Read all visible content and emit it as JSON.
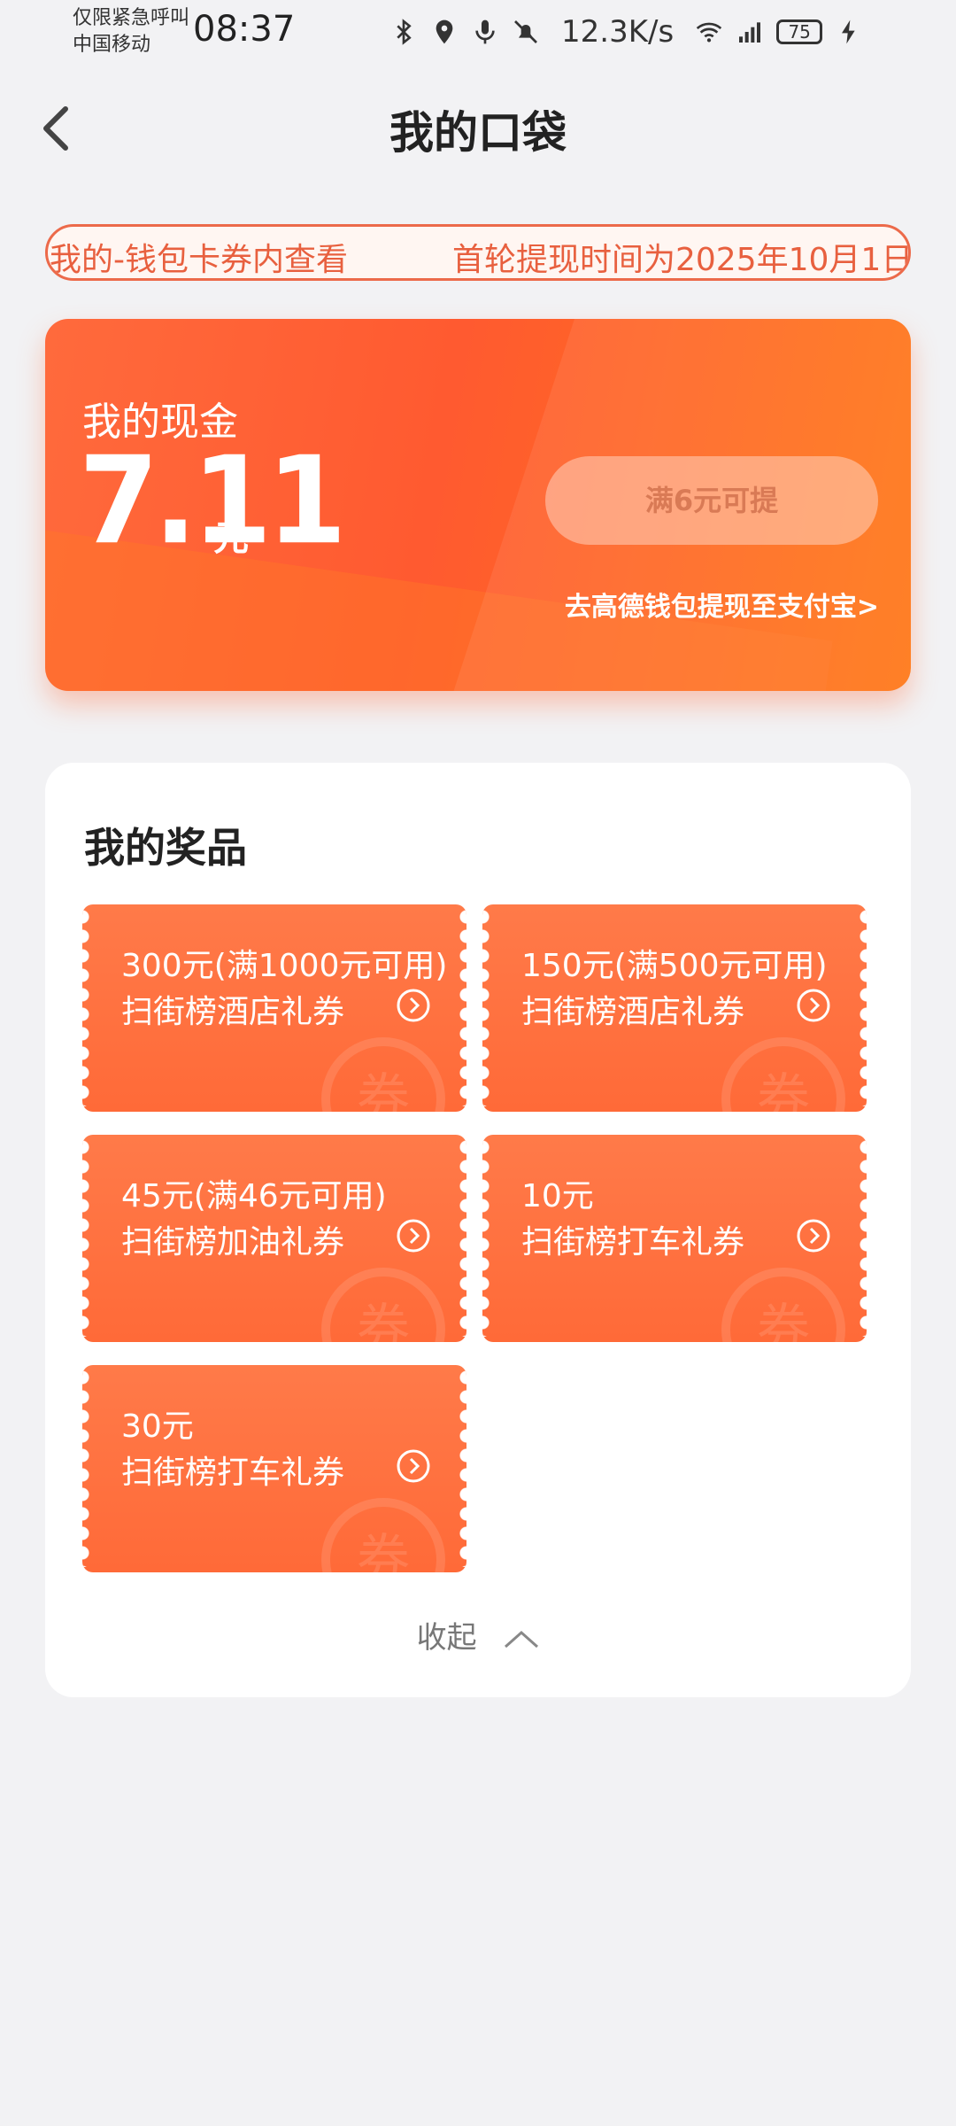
{
  "status_bar": {
    "carrier_line1": "仅限紧急呼叫",
    "carrier_line2": "中国移动",
    "time": "08:37",
    "speed": "12.3K/s",
    "battery": "75",
    "icons": [
      "bluetooth-icon",
      "location-icon",
      "mic-icon",
      "mute-bell-icon",
      "wifi-icon",
      "signal-icon",
      "charging-icon"
    ]
  },
  "nav": {
    "title": "我的口袋"
  },
  "notice": {
    "text1": "我的-钱包卡券内查看",
    "text2": "首轮提现时间为2025年10月1日"
  },
  "cash": {
    "label": "我的现金",
    "amount": "7.11",
    "unit": "元",
    "withdraw_button": "满6元可提",
    "wallet_link": "去高德钱包提现至支付宝>"
  },
  "prizes": {
    "title": "我的奖品",
    "coupons": [
      {
        "line1": "300元(满1000元可用)",
        "line2": "扫街榜酒店礼券"
      },
      {
        "line1": "150元(满500元可用)",
        "line2": "扫街榜酒店礼券"
      },
      {
        "line1": "45元(满46元可用)",
        "line2": "扫街榜加油礼券"
      },
      {
        "line1": "10元",
        "line2": "扫街榜打车礼券"
      },
      {
        "line1": "30元",
        "line2": "扫街榜打车礼券"
      }
    ],
    "watermark": "券",
    "collapse_label": "收起"
  },
  "colors": {
    "accent": "#ff6a3c",
    "background": "#f2f2f4"
  }
}
